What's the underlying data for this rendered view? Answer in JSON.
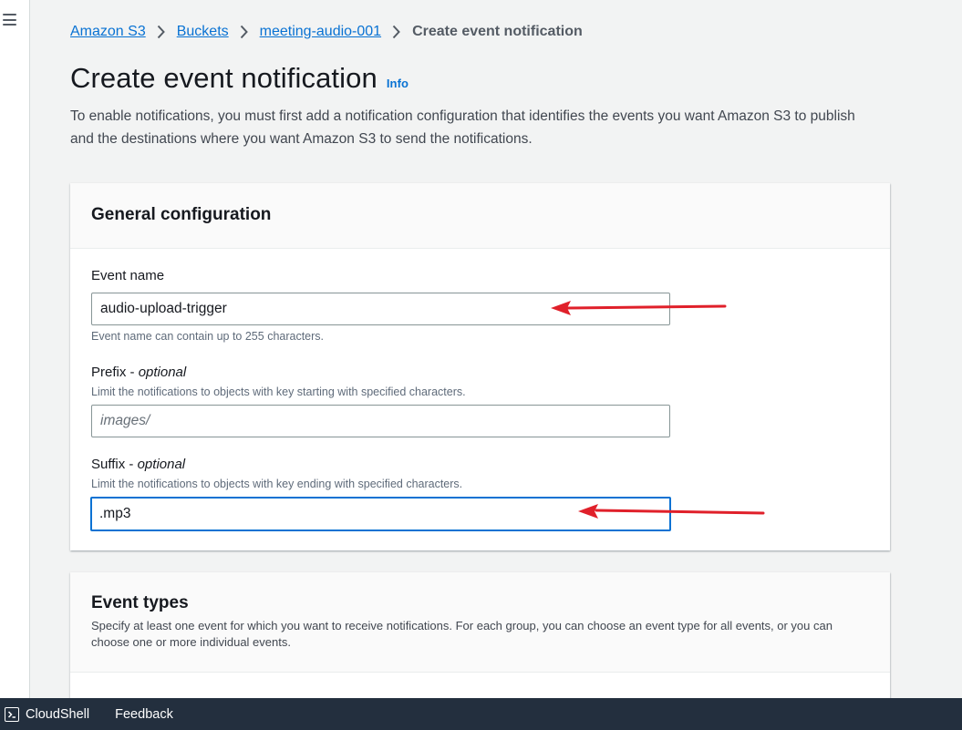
{
  "breadcrumb": {
    "items": [
      "Amazon S3",
      "Buckets",
      "meeting-audio-001"
    ],
    "current": "Create event notification"
  },
  "page": {
    "title": "Create event notification",
    "info_link": "Info",
    "description": "To enable notifications, you must first add a notification configuration that identifies the events you want Amazon S3 to publish and the destinations where you want Amazon S3 to send the notifications."
  },
  "general_config": {
    "title": "General configuration",
    "event_name": {
      "label": "Event name",
      "value": "audio-upload-trigger",
      "hint": "Event name can contain up to 255 characters."
    },
    "prefix": {
      "label": "Prefix",
      "label_suffix": "optional",
      "hint": "Limit the notifications to objects with key starting with specified characters.",
      "placeholder": "images/",
      "value": ""
    },
    "suffix": {
      "label": "Suffix",
      "label_suffix": "optional",
      "hint": "Limit the notifications to objects with key ending with specified characters.",
      "value": ".mp3"
    }
  },
  "event_types": {
    "title": "Event types",
    "description": "Specify at least one event for which you want to receive notifications. For each group, you can choose an event type for all events, or you can choose one or more individual events."
  },
  "bottom_bar": {
    "cloudshell": "CloudShell",
    "feedback": "Feedback"
  },
  "colors": {
    "link": "#0972d3",
    "annotation_arrow": "#e0202a",
    "bottom_bar": "#232f3e"
  },
  "icons": [
    "menu-icon",
    "chevron-right-icon",
    "cloudshell-icon"
  ]
}
